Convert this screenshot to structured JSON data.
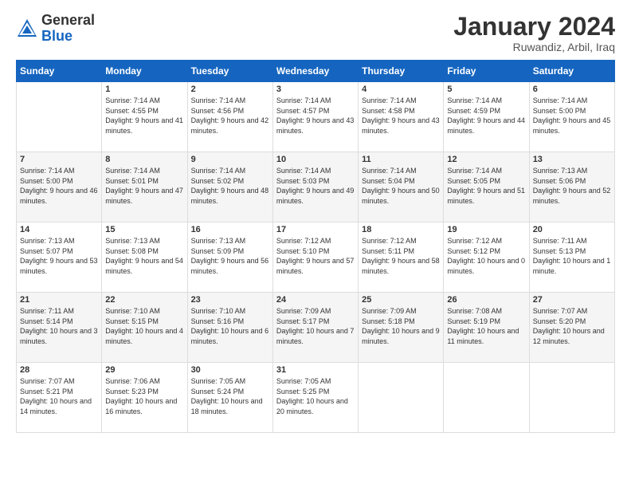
{
  "header": {
    "logo_general": "General",
    "logo_blue": "Blue",
    "main_title": "January 2024",
    "subtitle": "Ruwandiz, Arbil, Iraq"
  },
  "calendar": {
    "weekdays": [
      "Sunday",
      "Monday",
      "Tuesday",
      "Wednesday",
      "Thursday",
      "Friday",
      "Saturday"
    ],
    "weeks": [
      [
        {
          "day": "",
          "sunrise": "",
          "sunset": "",
          "daylight": ""
        },
        {
          "day": "1",
          "sunrise": "Sunrise: 7:14 AM",
          "sunset": "Sunset: 4:55 PM",
          "daylight": "Daylight: 9 hours and 41 minutes."
        },
        {
          "day": "2",
          "sunrise": "Sunrise: 7:14 AM",
          "sunset": "Sunset: 4:56 PM",
          "daylight": "Daylight: 9 hours and 42 minutes."
        },
        {
          "day": "3",
          "sunrise": "Sunrise: 7:14 AM",
          "sunset": "Sunset: 4:57 PM",
          "daylight": "Daylight: 9 hours and 43 minutes."
        },
        {
          "day": "4",
          "sunrise": "Sunrise: 7:14 AM",
          "sunset": "Sunset: 4:58 PM",
          "daylight": "Daylight: 9 hours and 43 minutes."
        },
        {
          "day": "5",
          "sunrise": "Sunrise: 7:14 AM",
          "sunset": "Sunset: 4:59 PM",
          "daylight": "Daylight: 9 hours and 44 minutes."
        },
        {
          "day": "6",
          "sunrise": "Sunrise: 7:14 AM",
          "sunset": "Sunset: 5:00 PM",
          "daylight": "Daylight: 9 hours and 45 minutes."
        }
      ],
      [
        {
          "day": "7",
          "sunrise": "Sunrise: 7:14 AM",
          "sunset": "Sunset: 5:00 PM",
          "daylight": "Daylight: 9 hours and 46 minutes."
        },
        {
          "day": "8",
          "sunrise": "Sunrise: 7:14 AM",
          "sunset": "Sunset: 5:01 PM",
          "daylight": "Daylight: 9 hours and 47 minutes."
        },
        {
          "day": "9",
          "sunrise": "Sunrise: 7:14 AM",
          "sunset": "Sunset: 5:02 PM",
          "daylight": "Daylight: 9 hours and 48 minutes."
        },
        {
          "day": "10",
          "sunrise": "Sunrise: 7:14 AM",
          "sunset": "Sunset: 5:03 PM",
          "daylight": "Daylight: 9 hours and 49 minutes."
        },
        {
          "day": "11",
          "sunrise": "Sunrise: 7:14 AM",
          "sunset": "Sunset: 5:04 PM",
          "daylight": "Daylight: 9 hours and 50 minutes."
        },
        {
          "day": "12",
          "sunrise": "Sunrise: 7:14 AM",
          "sunset": "Sunset: 5:05 PM",
          "daylight": "Daylight: 9 hours and 51 minutes."
        },
        {
          "day": "13",
          "sunrise": "Sunrise: 7:13 AM",
          "sunset": "Sunset: 5:06 PM",
          "daylight": "Daylight: 9 hours and 52 minutes."
        }
      ],
      [
        {
          "day": "14",
          "sunrise": "Sunrise: 7:13 AM",
          "sunset": "Sunset: 5:07 PM",
          "daylight": "Daylight: 9 hours and 53 minutes."
        },
        {
          "day": "15",
          "sunrise": "Sunrise: 7:13 AM",
          "sunset": "Sunset: 5:08 PM",
          "daylight": "Daylight: 9 hours and 54 minutes."
        },
        {
          "day": "16",
          "sunrise": "Sunrise: 7:13 AM",
          "sunset": "Sunset: 5:09 PM",
          "daylight": "Daylight: 9 hours and 56 minutes."
        },
        {
          "day": "17",
          "sunrise": "Sunrise: 7:12 AM",
          "sunset": "Sunset: 5:10 PM",
          "daylight": "Daylight: 9 hours and 57 minutes."
        },
        {
          "day": "18",
          "sunrise": "Sunrise: 7:12 AM",
          "sunset": "Sunset: 5:11 PM",
          "daylight": "Daylight: 9 hours and 58 minutes."
        },
        {
          "day": "19",
          "sunrise": "Sunrise: 7:12 AM",
          "sunset": "Sunset: 5:12 PM",
          "daylight": "Daylight: 10 hours and 0 minutes."
        },
        {
          "day": "20",
          "sunrise": "Sunrise: 7:11 AM",
          "sunset": "Sunset: 5:13 PM",
          "daylight": "Daylight: 10 hours and 1 minute."
        }
      ],
      [
        {
          "day": "21",
          "sunrise": "Sunrise: 7:11 AM",
          "sunset": "Sunset: 5:14 PM",
          "daylight": "Daylight: 10 hours and 3 minutes."
        },
        {
          "day": "22",
          "sunrise": "Sunrise: 7:10 AM",
          "sunset": "Sunset: 5:15 PM",
          "daylight": "Daylight: 10 hours and 4 minutes."
        },
        {
          "day": "23",
          "sunrise": "Sunrise: 7:10 AM",
          "sunset": "Sunset: 5:16 PM",
          "daylight": "Daylight: 10 hours and 6 minutes."
        },
        {
          "day": "24",
          "sunrise": "Sunrise: 7:09 AM",
          "sunset": "Sunset: 5:17 PM",
          "daylight": "Daylight: 10 hours and 7 minutes."
        },
        {
          "day": "25",
          "sunrise": "Sunrise: 7:09 AM",
          "sunset": "Sunset: 5:18 PM",
          "daylight": "Daylight: 10 hours and 9 minutes."
        },
        {
          "day": "26",
          "sunrise": "Sunrise: 7:08 AM",
          "sunset": "Sunset: 5:19 PM",
          "daylight": "Daylight: 10 hours and 11 minutes."
        },
        {
          "day": "27",
          "sunrise": "Sunrise: 7:07 AM",
          "sunset": "Sunset: 5:20 PM",
          "daylight": "Daylight: 10 hours and 12 minutes."
        }
      ],
      [
        {
          "day": "28",
          "sunrise": "Sunrise: 7:07 AM",
          "sunset": "Sunset: 5:21 PM",
          "daylight": "Daylight: 10 hours and 14 minutes."
        },
        {
          "day": "29",
          "sunrise": "Sunrise: 7:06 AM",
          "sunset": "Sunset: 5:23 PM",
          "daylight": "Daylight: 10 hours and 16 minutes."
        },
        {
          "day": "30",
          "sunrise": "Sunrise: 7:05 AM",
          "sunset": "Sunset: 5:24 PM",
          "daylight": "Daylight: 10 hours and 18 minutes."
        },
        {
          "day": "31",
          "sunrise": "Sunrise: 7:05 AM",
          "sunset": "Sunset: 5:25 PM",
          "daylight": "Daylight: 10 hours and 20 minutes."
        },
        {
          "day": "",
          "sunrise": "",
          "sunset": "",
          "daylight": ""
        },
        {
          "day": "",
          "sunrise": "",
          "sunset": "",
          "daylight": ""
        },
        {
          "day": "",
          "sunrise": "",
          "sunset": "",
          "daylight": ""
        }
      ]
    ]
  }
}
